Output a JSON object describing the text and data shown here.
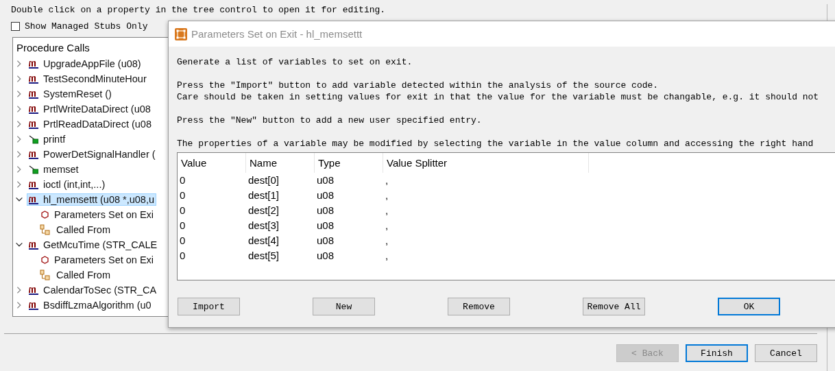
{
  "instructions": [
    "Double click on a property in the tree control to open it for editing."
  ],
  "show_managed_only": {
    "label": "Show Managed Stubs Only",
    "checked": false
  },
  "tree": {
    "title": "Procedure Calls",
    "items": [
      {
        "kind": "method",
        "label": "UpgradeAppFile (u08)",
        "expanded": false,
        "selected": false
      },
      {
        "kind": "method",
        "label": "TestSecondMinuteHour",
        "expanded": false,
        "selected": false
      },
      {
        "kind": "method",
        "label": "SystemReset ()",
        "expanded": false,
        "selected": false
      },
      {
        "kind": "method",
        "label": "PrtlWriteDataDirect (u08",
        "expanded": false,
        "selected": false
      },
      {
        "kind": "method",
        "label": "PrtlReadDataDirect (u08",
        "expanded": false,
        "selected": false
      },
      {
        "kind": "function",
        "label": "printf",
        "expanded": false,
        "selected": false
      },
      {
        "kind": "method",
        "label": "PowerDetSignalHandler (",
        "expanded": false,
        "selected": false
      },
      {
        "kind": "function",
        "label": "memset",
        "expanded": false,
        "selected": false
      },
      {
        "kind": "method",
        "label": "ioctl (int,int,...)",
        "expanded": false,
        "selected": false
      },
      {
        "kind": "method",
        "label": "hl_memsettt (u08 *,u08,u",
        "expanded": true,
        "selected": true,
        "children": [
          {
            "kind": "param",
            "label": "Parameters Set on Exi",
            "selected": false
          },
          {
            "kind": "caller",
            "label": "Called From",
            "selected": false
          }
        ]
      },
      {
        "kind": "method",
        "label": "GetMcuTime (STR_CALE",
        "expanded": true,
        "selected": false,
        "children": [
          {
            "kind": "param",
            "label": "Parameters Set on Exi",
            "selected": false
          },
          {
            "kind": "caller",
            "label": "Called From",
            "selected": false
          }
        ]
      },
      {
        "kind": "method",
        "label": "CalendarToSec (STR_CA",
        "expanded": false,
        "selected": false
      },
      {
        "kind": "method",
        "label": "BsdiffLzmaAlgorithm (u0",
        "expanded": false,
        "selected": false
      }
    ]
  },
  "dialog": {
    "title": "Parameters Set on Exit - hl_memsettt",
    "paragraphs": [
      [
        "Generate a list of variables to set on exit."
      ],
      [
        "Press the \"Import\" button to add variable detected within the analysis of the source code.",
        "Care should be taken in setting values for exit in that the value for the variable must be changable, e.g. it should not"
      ],
      [
        "Press the \"New\" button to add a new user specified entry."
      ],
      [
        "The properties of a variable may be modified by selecting the variable in the value column and accessing the right hand"
      ]
    ],
    "table": {
      "columns": [
        "Value",
        "Name",
        "Type",
        "Value Splitter"
      ],
      "rows": [
        [
          "0",
          "dest[0]",
          "u08",
          ","
        ],
        [
          "0",
          "dest[1]",
          "u08",
          ","
        ],
        [
          "0",
          "dest[2]",
          "u08",
          ","
        ],
        [
          "0",
          "dest[3]",
          "u08",
          ","
        ],
        [
          "0",
          "dest[4]",
          "u08",
          ","
        ],
        [
          "0",
          "dest[5]",
          "u08",
          ","
        ]
      ]
    },
    "buttons": [
      {
        "label": "Import",
        "default": false
      },
      {
        "label": "New",
        "default": false
      },
      {
        "label": "Remove",
        "default": false
      },
      {
        "label": "Remove All",
        "default": false
      },
      {
        "label": "OK",
        "default": true
      }
    ]
  },
  "wizard_buttons": [
    {
      "label": "< Back",
      "disabled": true,
      "default": false
    },
    {
      "label": "Finish",
      "disabled": false,
      "default": true
    },
    {
      "label": "Cancel",
      "disabled": false,
      "default": false
    }
  ]
}
